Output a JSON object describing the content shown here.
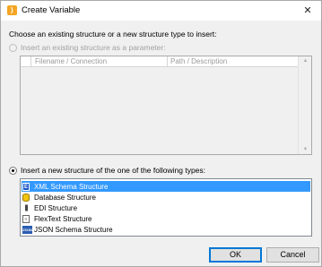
{
  "window": {
    "title": "Create Variable",
    "app_icon_glyph": "⟩",
    "close_glyph": "✕"
  },
  "prompt": "Choose an existing structure or a new structure type to insert:",
  "option_existing": {
    "label": "Insert an existing structure as a parameter:",
    "enabled": false,
    "checked": false,
    "columns": [
      "Filename / Connection",
      "Path / Description"
    ]
  },
  "option_new": {
    "label": "Insert a new structure of the one of the following types:",
    "checked": true,
    "items": [
      {
        "label": "XML Schema Structure",
        "icon": "xml-schema-icon",
        "glyph": "E",
        "selected": true
      },
      {
        "label": "Database Structure",
        "icon": "database-icon",
        "glyph": "",
        "selected": false
      },
      {
        "label": "EDI Structure",
        "icon": "edi-icon",
        "glyph": "|||",
        "selected": false
      },
      {
        "label": "FlexText Structure",
        "icon": "flextext-icon",
        "glyph": "≡",
        "selected": false
      },
      {
        "label": "JSON Schema Structure",
        "icon": "json-schema-icon",
        "glyph": "JSON",
        "selected": false
      }
    ]
  },
  "buttons": {
    "ok": "OK",
    "cancel": "Cancel"
  },
  "colors": {
    "selection": "#3399ff",
    "app_icon": "#f5a623",
    "default_button_border": "#0078d7"
  }
}
